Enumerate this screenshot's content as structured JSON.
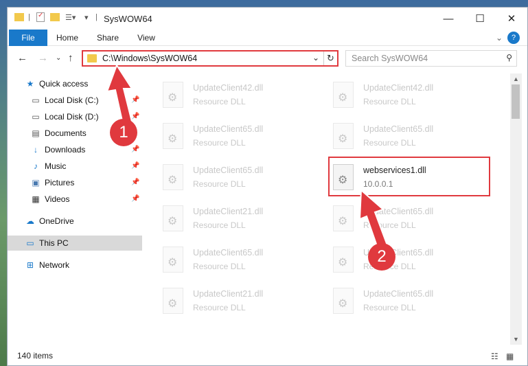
{
  "window": {
    "title": "SysWOW64"
  },
  "ribbon": {
    "tabs": [
      "File",
      "Home",
      "Share",
      "View"
    ]
  },
  "address": {
    "path": "C:\\Windows\\SysWOW64"
  },
  "search": {
    "placeholder": "Search SysWOW64"
  },
  "sidebar": {
    "items": [
      {
        "label": "Quick access",
        "icon": "star-icon"
      },
      {
        "label": "Local Disk (C:)",
        "icon": "drive-icon"
      },
      {
        "label": "Local Disk (D:)",
        "icon": "drive-icon"
      },
      {
        "label": "Documents",
        "icon": "documents-icon"
      },
      {
        "label": "Downloads",
        "icon": "download-icon"
      },
      {
        "label": "Music",
        "icon": "music-icon"
      },
      {
        "label": "Pictures",
        "icon": "pictures-icon"
      },
      {
        "label": "Videos",
        "icon": "videos-icon"
      },
      {
        "label": "OneDrive",
        "icon": "cloud-icon"
      },
      {
        "label": "This PC",
        "icon": "computer-icon"
      },
      {
        "label": "Network",
        "icon": "network-icon"
      }
    ]
  },
  "files": {
    "left": [
      {
        "name": "UpdateClient42.dll",
        "desc": "Resource DLL"
      },
      {
        "name": "UpdateClient65.dll",
        "desc": "Resource DLL"
      },
      {
        "name": "UpdateClient65.dll",
        "desc": "Resource DLL"
      },
      {
        "name": "UpdateClient21.dll",
        "desc": "Resource DLL"
      },
      {
        "name": "UpdateClient65.dll",
        "desc": "Resource DLL"
      },
      {
        "name": "UpdateClient21.dll",
        "desc": "Resource DLL"
      }
    ],
    "right": [
      {
        "name": "UpdateClient42.dll",
        "desc": "Resource DLL"
      },
      {
        "name": "UpdateClient65.dll",
        "desc": "Resource DLL"
      },
      {
        "name": "webservices1.dll",
        "desc": "10.0.0.1"
      },
      {
        "name": "UpdateClient65.dll",
        "desc": "Resource DLL"
      },
      {
        "name": "UpdateClient65.dll",
        "desc": "Resource DLL"
      },
      {
        "name": "UpdateClient65.dll",
        "desc": "Resource DLL"
      }
    ]
  },
  "status": {
    "count": "140 items"
  },
  "callouts": {
    "one": "1",
    "two": "2"
  },
  "colors": {
    "accent": "#1979ca",
    "highlight": "#e0393e"
  }
}
